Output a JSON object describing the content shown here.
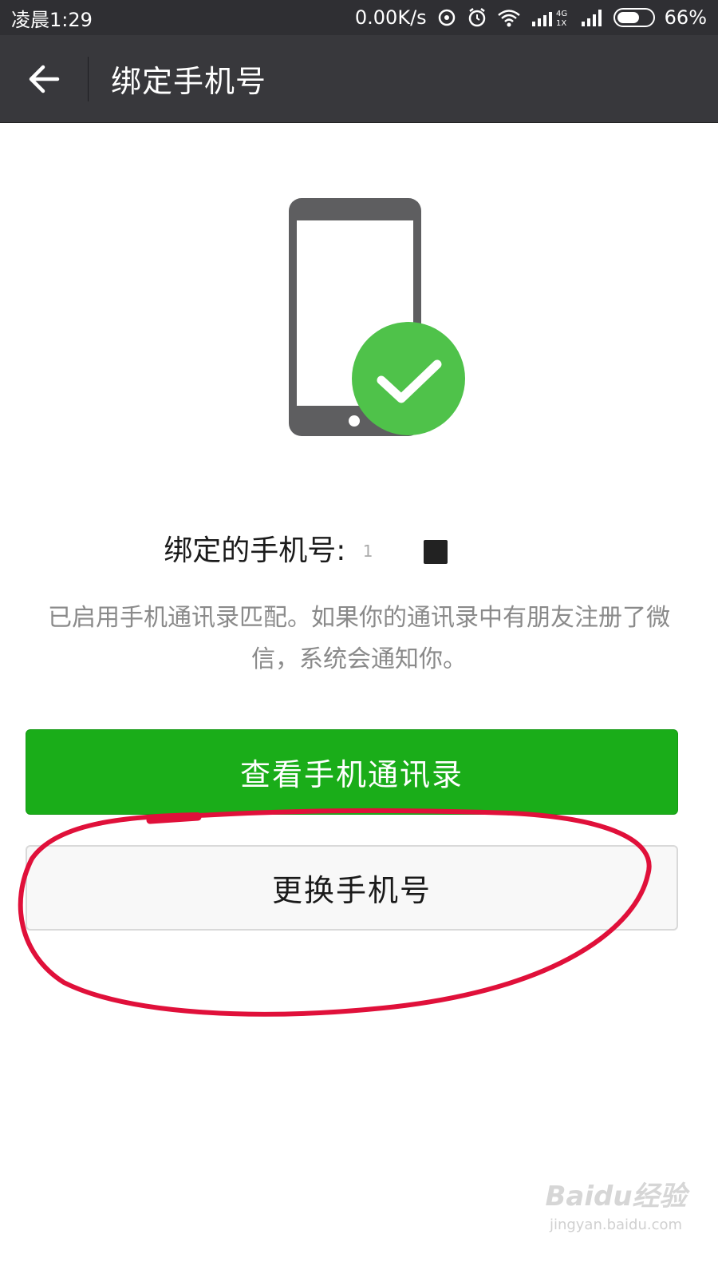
{
  "status_bar": {
    "time": "凌晨1:29",
    "net_speed": "0.00K/s",
    "battery": "66%",
    "battery_level": 0.66,
    "icons": [
      "sync-icon",
      "alarm-icon",
      "wifi-icon",
      "signal-4g-icon",
      "signal-icon",
      "battery-icon"
    ]
  },
  "header": {
    "title": "绑定手机号",
    "back_icon": "back-arrow-icon"
  },
  "illustration": {
    "icon": "phone-verified-icon",
    "phone_color": "#5e5e60",
    "check_color": "#4fc24a"
  },
  "main": {
    "bound_label": "绑定的手机号:",
    "description": "已启用手机通讯录匹配。如果你的通讯录中有朋友注册了微信，系统会通知你。"
  },
  "buttons": {
    "view_contacts": "查看手机通讯录",
    "change_number": "更换手机号"
  },
  "colors": {
    "accent": "#1aad19",
    "header_bg": "#38383c",
    "annotation": "#e0103a"
  },
  "watermark": {
    "logo": "Baidu经验",
    "url": "jingyan.baidu.com"
  }
}
